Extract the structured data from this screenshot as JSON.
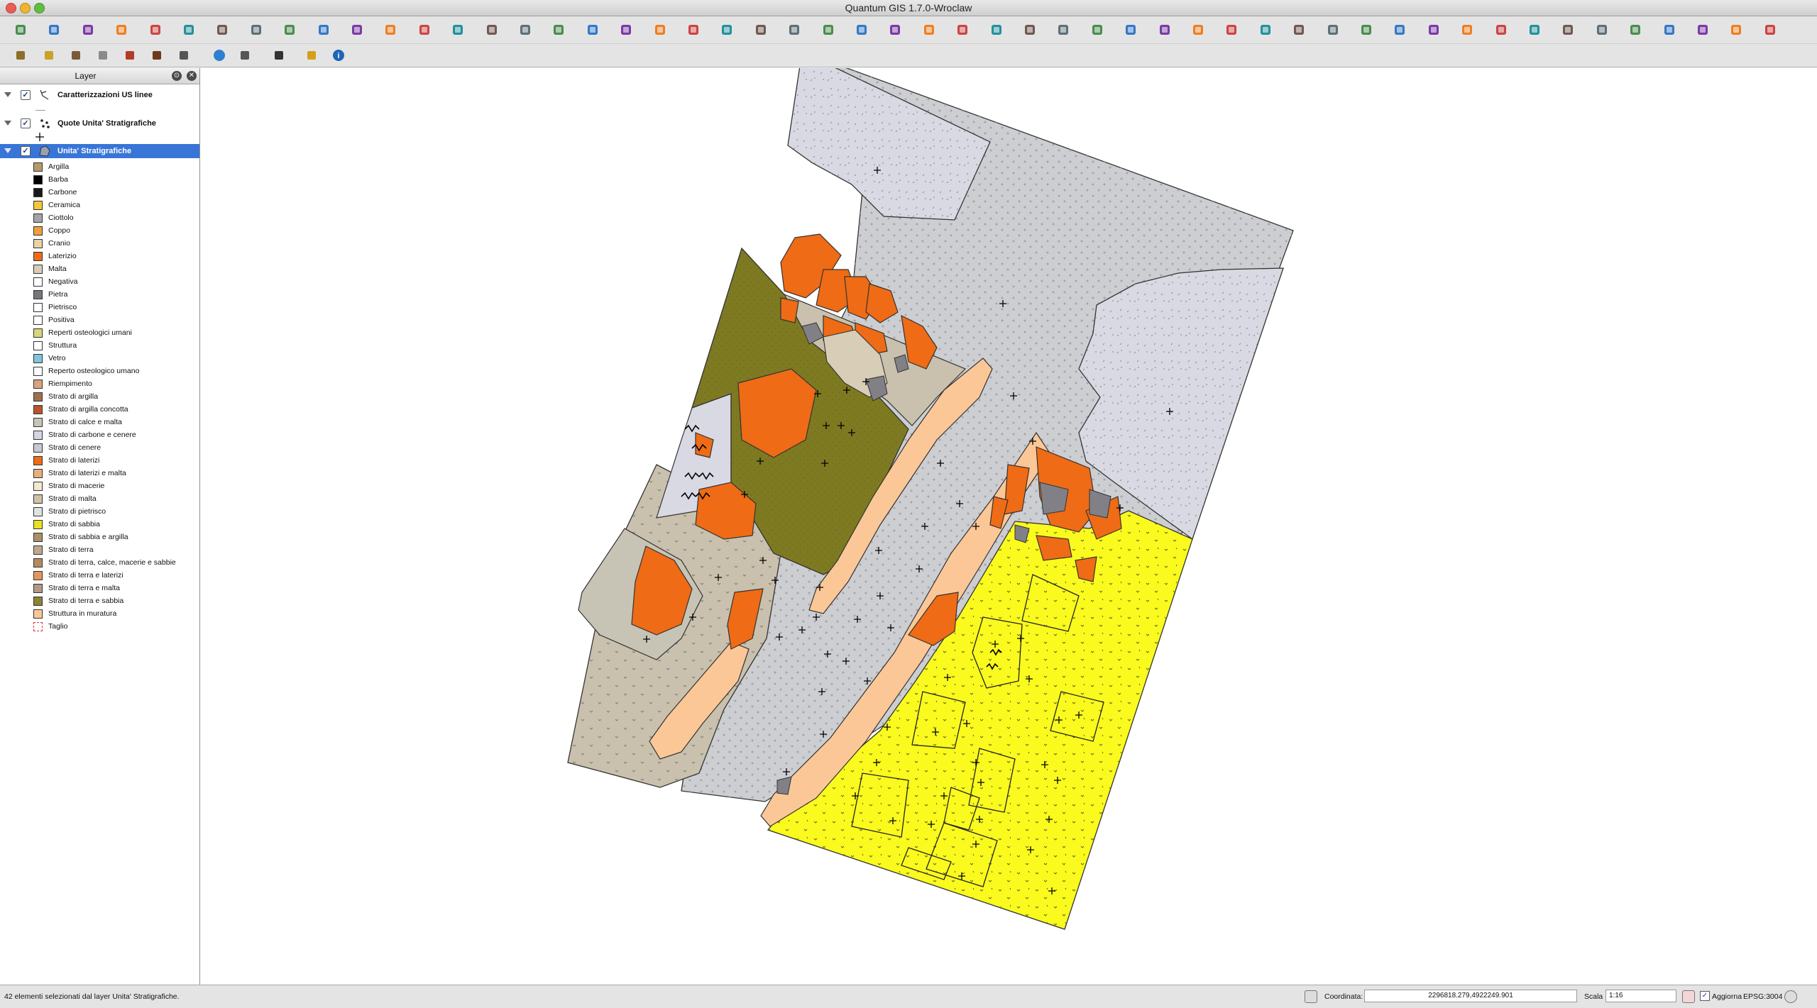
{
  "window": {
    "title": "Quantum GIS 1.7.0-Wroclaw"
  },
  "colors": {
    "selection": "#3875d7",
    "laterizio": "#ef6b15",
    "sabbia": "#fafa1e",
    "cenere": "#cdced2",
    "argilla_sabbia": "#7e7a21",
    "struttura_muratura": "#fbc797",
    "terra": "#c9c1ad",
    "carbone_cenere": "#d8d9e2",
    "pietra": "#808086"
  },
  "toolbar1": {
    "icons": [
      "new-project-icon",
      "open-project-icon",
      "save-project-icon",
      "save-as-icon",
      "add-layer-icon",
      "add-star-icon",
      "remove-layer-icon",
      "undo-icon",
      "redo-icon",
      "pan-map-icon",
      "zoom-in-icon",
      "zoom-out-icon",
      "zoom-full-icon",
      "zoom-layer-icon",
      "zoom-last-icon",
      "zoom-next-icon",
      "refresh-icon",
      "edit-pencil-icon",
      "save-edits-icon",
      "move-feature-icon",
      "node-tool-icon",
      "delete-feature-icon",
      "cut-icon",
      "copy-icon",
      "paste-icon",
      "pan-hand-icon",
      "zoom-plus-icon",
      "zoom-minus-icon",
      "zoom-extent-icon",
      "zoom-selection-icon",
      "zoom-native-icon",
      "zoom-in-alt-icon",
      "zoom-out-alt-icon",
      "refresh-map-icon",
      "add-vector-icon",
      "add-raster-icon",
      "identify-icon",
      "whats-this-icon",
      "measure-icon",
      "measure-area-icon",
      "select-icon",
      "deselect-icon",
      "attribute-table-icon",
      "map-tips-icon",
      "new-bookmark-icon",
      "show-bookmarks-icon",
      "label-icon",
      "annotation-icon",
      "text-icon",
      "new-composer-icon",
      "composer-manager-icon",
      "print-composer-icon",
      "print-icon"
    ]
  },
  "toolbar2": {
    "icons": [
      "plugin-icon",
      "database-icon",
      "shoe-icon",
      "tool-sheet-icon",
      "cart-icon",
      "boot-icon",
      "tower-icon",
      "globe-icon",
      "sync-icon",
      "camera-icon",
      "python-icon",
      "info-icon"
    ]
  },
  "layers_panel": {
    "title": "Layer",
    "layers": [
      {
        "name": "Caratterizzazioni US linee",
        "checked": true,
        "icon": "line-layer-icon"
      },
      {
        "name": "Quote Unita' Stratigrafiche",
        "checked": true,
        "icon": "point-layer-icon"
      },
      {
        "name": "Unita' Stratigrafiche",
        "checked": true,
        "icon": "polygon-layer-icon",
        "selected": true
      }
    ],
    "legend": [
      {
        "label": "Argilla",
        "color": "#b59a6a"
      },
      {
        "label": "Barba",
        "color": "#000000"
      },
      {
        "label": "Carbone",
        "color": "#1a1a1a"
      },
      {
        "label": "Ceramica",
        "color": "#f4c63a"
      },
      {
        "label": "Ciottolo",
        "color": "#a4a4a4"
      },
      {
        "label": "Coppo",
        "color": "#f0a03a"
      },
      {
        "label": "Cranio",
        "color": "#e8d3a3"
      },
      {
        "label": "Laterizio",
        "color": "#ef6b15"
      },
      {
        "label": "Malta",
        "color": "#d7cdb9"
      },
      {
        "label": "Negativa",
        "color": "#ffffff"
      },
      {
        "label": "Pietra",
        "color": "#76777d"
      },
      {
        "label": "Pietrisco",
        "color": "#ffffff"
      },
      {
        "label": "Positiva",
        "color": "#ffffff"
      },
      {
        "label": "Reperti osteologici umani",
        "color": "#d7d67a"
      },
      {
        "label": "Struttura",
        "color": "#ffffff"
      },
      {
        "label": "Vetro",
        "color": "#7fc4db"
      },
      {
        "label": "Reperto osteologico umano",
        "color": "#ffffff"
      },
      {
        "label": "Riempimento",
        "color": "#d9a37d"
      },
      {
        "label": "Strato di argilla",
        "color": "#a0704a"
      },
      {
        "label": "Strato di argilla concotta",
        "color": "#b8552a"
      },
      {
        "label": "Strato di calce e malta",
        "color": "#c9c4b8"
      },
      {
        "label": "Strato di carbone e cenere",
        "color": "#d3d6e4"
      },
      {
        "label": "Strato di cenere",
        "color": "#c7c8d0"
      },
      {
        "label": "Strato di laterizi",
        "color": "#ef6b15"
      },
      {
        "label": "Strato di laterizi e malta",
        "color": "#e7b07a"
      },
      {
        "label": "Strato di macerie",
        "color": "#f2ead0"
      },
      {
        "label": "Strato di malta",
        "color": "#cfc3a6"
      },
      {
        "label": "Strato di pietrisco",
        "color": "#dee3e3"
      },
      {
        "label": "Strato di sabbia",
        "color": "#e8e320"
      },
      {
        "label": "Strato di sabbia e argilla",
        "color": "#a8906a"
      },
      {
        "label": "Strato di terra",
        "color": "#bca98a"
      },
      {
        "label": "Strato di terra, calce, macerie e sabbie",
        "color": "#b58a5d"
      },
      {
        "label": "Strato di terra e laterizi",
        "color": "#e6955a"
      },
      {
        "label": "Strato di terra e malta",
        "color": "#b39985"
      },
      {
        "label": "Strato di terra e sabbia",
        "color": "#8d8332"
      },
      {
        "label": "Struttura in muratura",
        "color": "#fbc797"
      },
      {
        "label": "Taglio",
        "color": "#ffffff"
      }
    ]
  },
  "statusbar": {
    "message": "42 elementi selezionati dal layer Unita' Stratigrafiche.",
    "coord_label": "Coordinata:",
    "coord_value": "2296818.279,4922249.901",
    "scale_label": "Scala",
    "scale_value": "1:16",
    "render_label": "Aggiorna",
    "crs": "EPSG:3004"
  }
}
